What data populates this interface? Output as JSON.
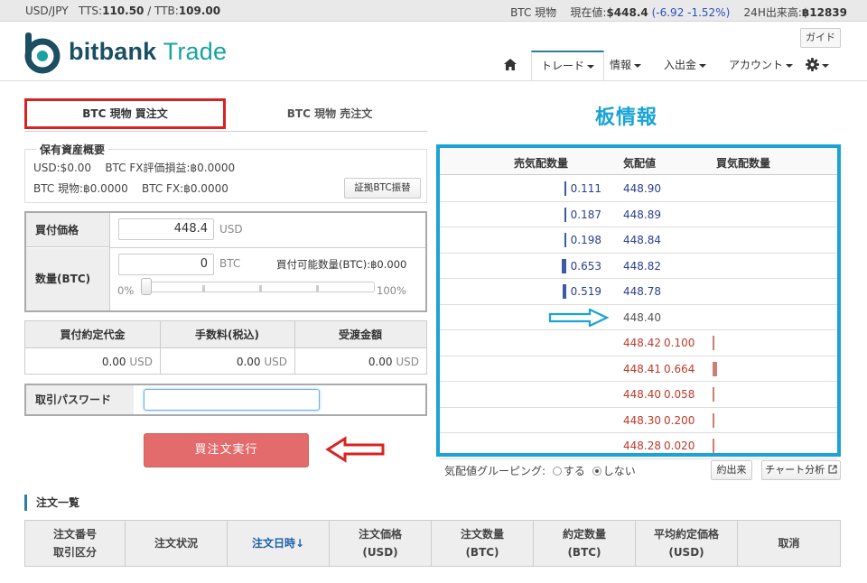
{
  "ticker": {
    "pair": "USD/JPY",
    "tts_label": "TTS:",
    "tts_value": "110.50",
    "ttb_label": "/ TTB:",
    "ttb_value": "109.00",
    "market": "BTC 現物",
    "price_label": "現在値:",
    "price_value": "$448.4",
    "change": "(-6.92 -1.52%)",
    "volume_label": "24H出来高:",
    "volume_value": "฿12839"
  },
  "logo": {
    "word1": "bitbank",
    "word2": "Trade"
  },
  "header": {
    "guide_label": "ガイド",
    "nav": [
      "トレード",
      "情報",
      "入出金",
      "アカウント"
    ]
  },
  "tabs": {
    "buy": "BTC 現物 買注文",
    "sell": "BTC 現物 売注文"
  },
  "board_title": "板情報",
  "assets": {
    "legend": "保有資産概要",
    "usd": "USD:$0.00",
    "fx_pl": "BTC FX評価損益:฿0.0000",
    "btc_spot": "BTC 現物:฿0.0000",
    "btc_fx": "BTC FX:฿0.0000",
    "evidence_button": "証拠BTC振替"
  },
  "order_form": {
    "price_label": "買付価格",
    "price_value": "448.4",
    "price_unit": "USD",
    "qty_label": "数量(BTC)",
    "qty_value": "0",
    "qty_unit": "BTC",
    "available": "買付可能数量(BTC):฿0.000",
    "slider_min": "0%",
    "slider_max": "100%",
    "slider_level": 0
  },
  "summary": {
    "headers": [
      "買付約定代金",
      "手数料(税込)",
      "受渡金額"
    ],
    "values": [
      "0.00",
      "0.00",
      "0.00"
    ],
    "unit": "USD"
  },
  "password": {
    "label": "取引パスワード",
    "value": ""
  },
  "execute_label": "買注文実行",
  "orderbook": {
    "headers": {
      "ask_qty": "売気配数量",
      "price": "気配値",
      "bid_qty": "買気配数量"
    },
    "asks": [
      {
        "qty": "0.111",
        "price": "448.90",
        "rel": 0.17
      },
      {
        "qty": "0.187",
        "price": "448.89",
        "rel": 0.29
      },
      {
        "qty": "0.198",
        "price": "448.84",
        "rel": 0.3
      },
      {
        "qty": "0.653",
        "price": "448.82",
        "rel": 1.0
      },
      {
        "qty": "0.519",
        "price": "448.78",
        "rel": 0.79
      }
    ],
    "mid": "448.40",
    "bids": [
      {
        "price": "448.42",
        "qty": "0.100",
        "rel": 0.15
      },
      {
        "price": "448.41",
        "qty": "0.664",
        "rel": 1.0
      },
      {
        "price": "448.40",
        "qty": "0.058",
        "rel": 0.09
      },
      {
        "price": "448.30",
        "qty": "0.200",
        "rel": 0.3
      },
      {
        "price": "448.28",
        "qty": "0.020",
        "rel": 0.03
      }
    ],
    "grouping_label": "気配値グルーピング:",
    "grouping_on": "する",
    "grouping_off": "しない",
    "trades_button": "約出来",
    "chart_button": "チャート分析"
  },
  "orders": {
    "title": "注文一覧",
    "headers": [
      [
        "注文番号",
        "取引区分"
      ],
      [
        "注文状況"
      ],
      [
        "注文日時↓"
      ],
      [
        "注文価格",
        "(USD)"
      ],
      [
        "注文数量",
        "(BTC)"
      ],
      [
        "約定数量",
        "(BTC)"
      ],
      [
        "平均約定価格",
        "(USD)"
      ],
      [
        "取消"
      ]
    ]
  },
  "colors": {
    "accent": "#1aa3d6",
    "highlight_red": "#d92323",
    "execute": "#e36b6b",
    "ask": "#2a3f8f",
    "bid": "#c0392b"
  }
}
